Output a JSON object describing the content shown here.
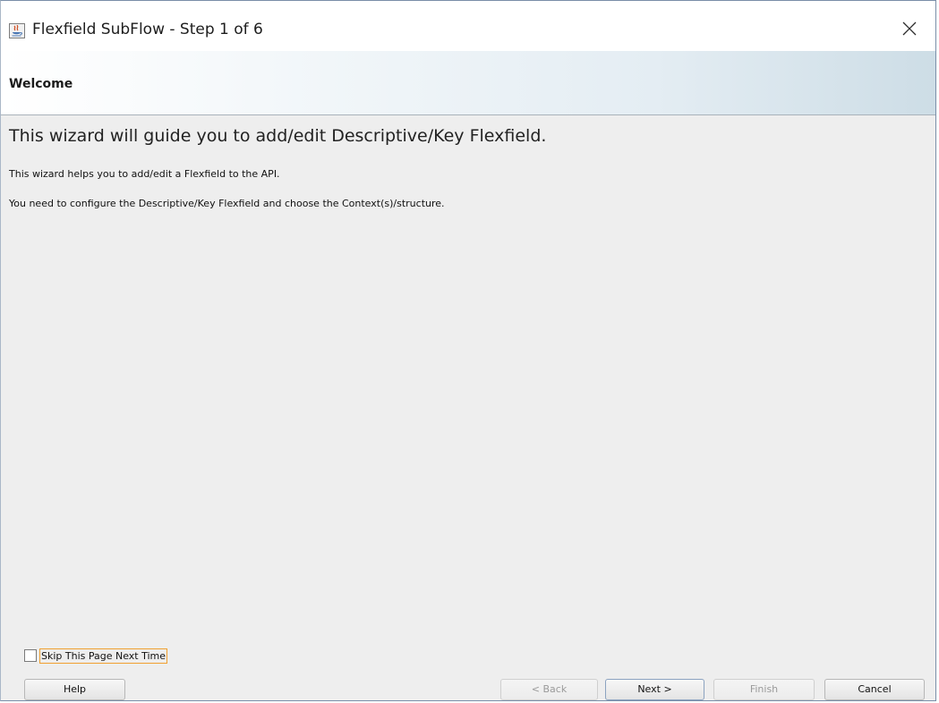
{
  "window": {
    "title": "Flexfield SubFlow - Step 1 of 6"
  },
  "header": {
    "title": "Welcome"
  },
  "content": {
    "heading": "This wizard will guide you to add/edit Descriptive/Key Flexfield.",
    "line1": "This wizard helps you to add/edit a Flexfield to the API.",
    "line2": "You need to configure the Descriptive/Key Flexfield and choose the Context(s)/structure."
  },
  "footer": {
    "skip_checkbox": {
      "label": "Skip This Page Next Time",
      "checked": false
    },
    "buttons": {
      "help": "Help",
      "back": "< Back",
      "next": "Next >",
      "finish": "Finish",
      "cancel": "Cancel"
    }
  },
  "icons": {
    "app": "java-app-icon",
    "close": "close-icon"
  }
}
